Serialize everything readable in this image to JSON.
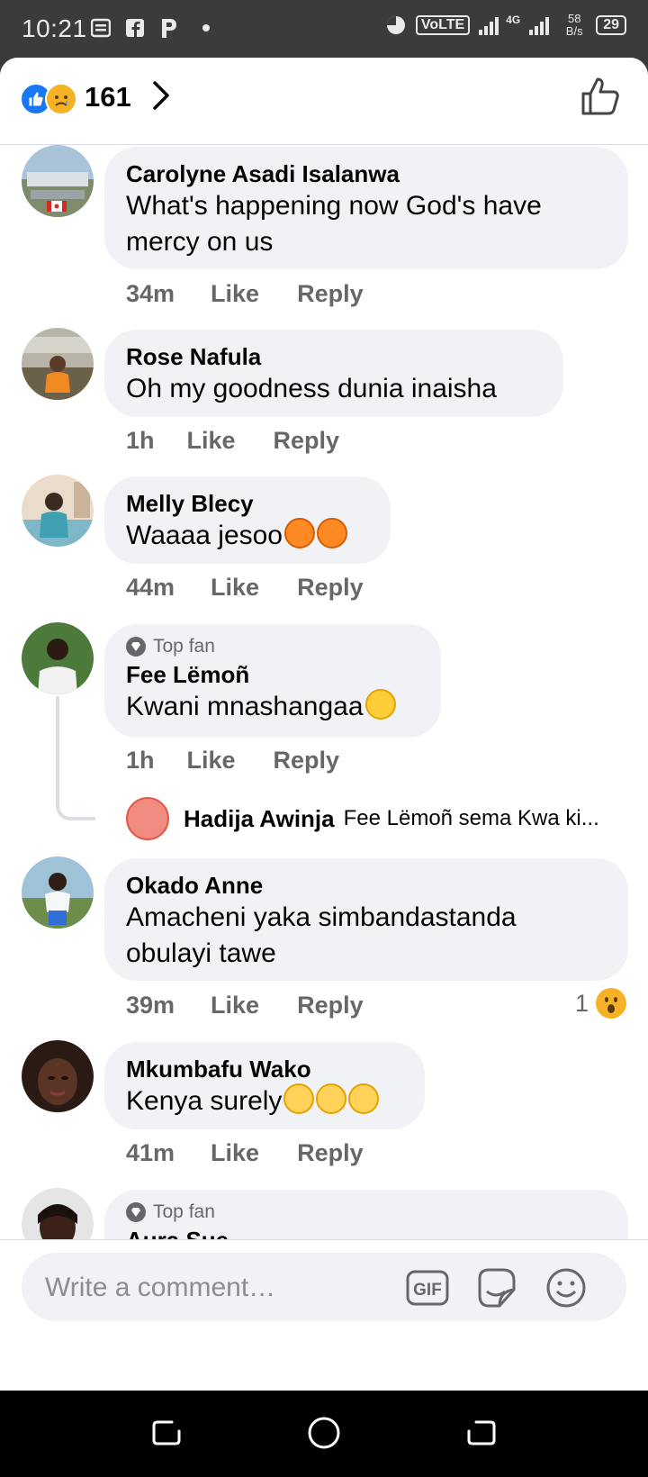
{
  "status_bar": {
    "time": "10:21",
    "volte": "VoLTE",
    "network": "4G",
    "speed": "58 B/s",
    "battery": "29"
  },
  "header": {
    "reaction_count": "161",
    "like_icon": "thumbs-up-icon"
  },
  "comments": [
    {
      "name": "Carolyne Asadi Isalanwa",
      "text_line1": "What's happening now God's have",
      "text_line2": "mercy on us",
      "time": "34m",
      "like": "Like",
      "reply": "Reply"
    },
    {
      "name": "Rose Nafula",
      "text": "Oh my goodness  dunia  inaisha",
      "time": "1h",
      "like": "Like",
      "reply": "Reply"
    },
    {
      "name": "Melly  Blecy",
      "text": "Waaaa jesoo",
      "time": "44m",
      "like": "Like",
      "reply": "Reply"
    },
    {
      "badge": "Top fan",
      "name": "Fee Lëmoñ",
      "text": "Kwani mnashangaa",
      "time": "1h",
      "like": "Like",
      "reply": "Reply",
      "reply_preview": {
        "name": "Hadija Awinja",
        "text": "Fee Lëmoñ sema Kwa ki..."
      }
    },
    {
      "name": "Okado Anne",
      "text_line1": "Amacheni yaka simbandastanda",
      "text_line2": "obulayi tawe",
      "time": "39m",
      "like": "Like",
      "reply": "Reply",
      "reaction_count": "1"
    },
    {
      "name": "Mkumbafu Wako",
      "text": "Kenya surely",
      "time": "41m",
      "like": "Like",
      "reply": "Reply"
    },
    {
      "badge": "Top fan",
      "name": "Aura Sue"
    }
  ],
  "composer": {
    "placeholder": "Write a comment…",
    "gif_label": "GIF"
  },
  "colors": {
    "brand_blue": "#1877f2",
    "bubble_bg": "#f0f2f5",
    "meta_gray": "#65676b"
  }
}
